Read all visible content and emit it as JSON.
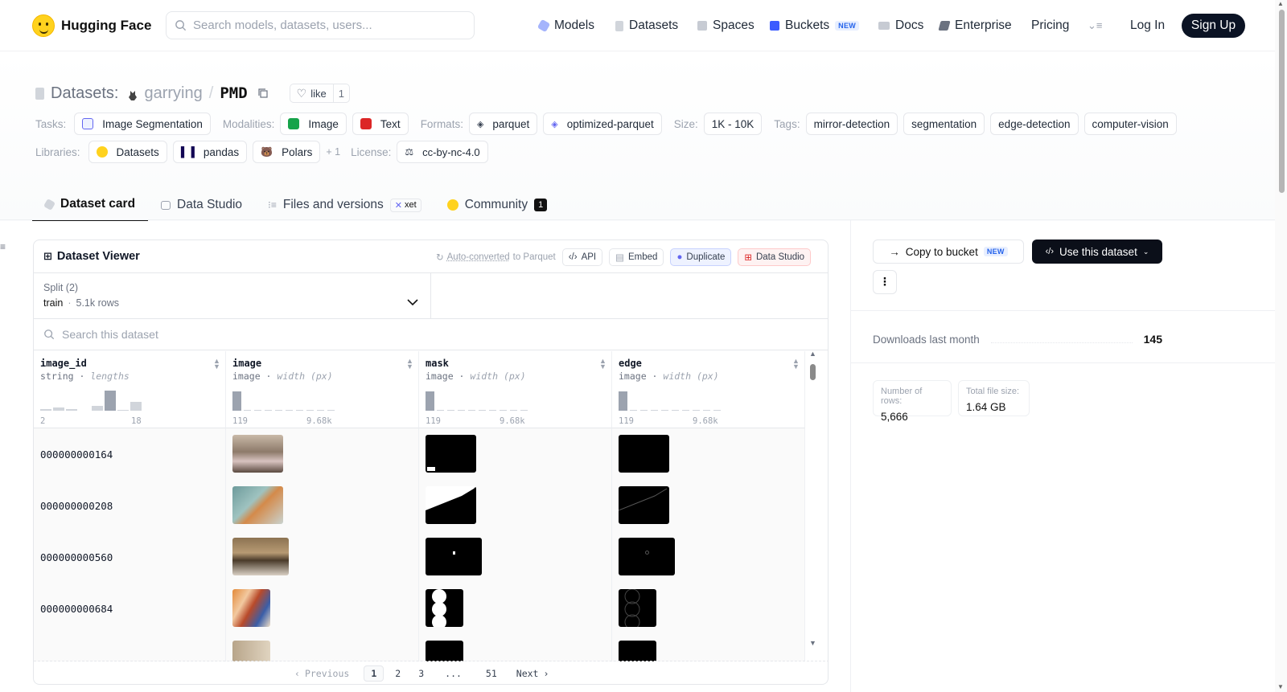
{
  "nav": {
    "brand": "Hugging Face",
    "search_placeholder": "Search models, datasets, users...",
    "items": [
      {
        "label": "Models"
      },
      {
        "label": "Datasets"
      },
      {
        "label": "Spaces"
      },
      {
        "label": "Buckets",
        "badge": "NEW"
      },
      {
        "label": "Docs"
      },
      {
        "label": "Enterprise"
      },
      {
        "label": "Pricing"
      }
    ],
    "login": "Log In",
    "signup": "Sign Up"
  },
  "repo": {
    "type_label": "Datasets:",
    "owner": "garrying",
    "separator": "/",
    "name": "PMD",
    "like_label": "like",
    "like_count": "1"
  },
  "meta": {
    "tasks_label": "Tasks:",
    "tasks": [
      "Image Segmentation"
    ],
    "modalities_label": "Modalities:",
    "modalities": [
      "Image",
      "Text"
    ],
    "formats_label": "Formats:",
    "formats": [
      "parquet",
      "optimized-parquet"
    ],
    "size_label": "Size:",
    "size": "1K - 10K",
    "tags_label": "Tags:",
    "tags": [
      "mirror-detection",
      "segmentation",
      "edge-detection",
      "computer-vision"
    ],
    "libraries_label": "Libraries:",
    "libraries": [
      "Datasets",
      "pandas",
      "Polars"
    ],
    "libraries_more": "+ 1",
    "license_label": "License:",
    "license": "cc-by-nc-4.0"
  },
  "tabs": [
    {
      "label": "Dataset card",
      "active": true
    },
    {
      "label": "Data Studio"
    },
    {
      "label": "Files and versions",
      "badge": "xet"
    },
    {
      "label": "Community",
      "count": "1"
    }
  ],
  "viewer": {
    "title": "Dataset Viewer",
    "auto_link": "Auto-converted",
    "auto_rest": " to Parquet",
    "buttons": [
      "API",
      "Embed",
      "Duplicate",
      "Data Studio"
    ],
    "split_label": "Split (2)",
    "split_name": "train",
    "split_rows": "5.1k rows",
    "search_placeholder": "Search this dataset",
    "columns": [
      {
        "name": "image_id",
        "type": "string",
        "stat": "lengths",
        "min": "2",
        "max": "18"
      },
      {
        "name": "image",
        "type": "image",
        "stat": "width (px)",
        "min": "119",
        "max": "9.68k"
      },
      {
        "name": "mask",
        "type": "image",
        "stat": "width (px)",
        "min": "119",
        "max": "9.68k"
      },
      {
        "name": "edge",
        "type": "image",
        "stat": "width (px)",
        "min": "119",
        "max": "9.68k"
      }
    ],
    "rows": [
      {
        "image_id": "000000000164"
      },
      {
        "image_id": "000000000208"
      },
      {
        "image_id": "000000000560"
      },
      {
        "image_id": "000000000684"
      },
      {
        "image_id": ""
      }
    ],
    "pagination": {
      "prev": "Previous",
      "pages": [
        "1",
        "2",
        "3",
        "...",
        "51"
      ],
      "current": "1",
      "next": "Next"
    }
  },
  "sidebar": {
    "copy_label": "Copy to bucket",
    "copy_badge": "NEW",
    "use_label": "Use this dataset",
    "downloads_label": "Downloads last month",
    "downloads_value": "145",
    "rows_label": "Number of rows:",
    "rows_value": "5,666",
    "size_label": "Total file size:",
    "size_value": "1.64 GB"
  }
}
